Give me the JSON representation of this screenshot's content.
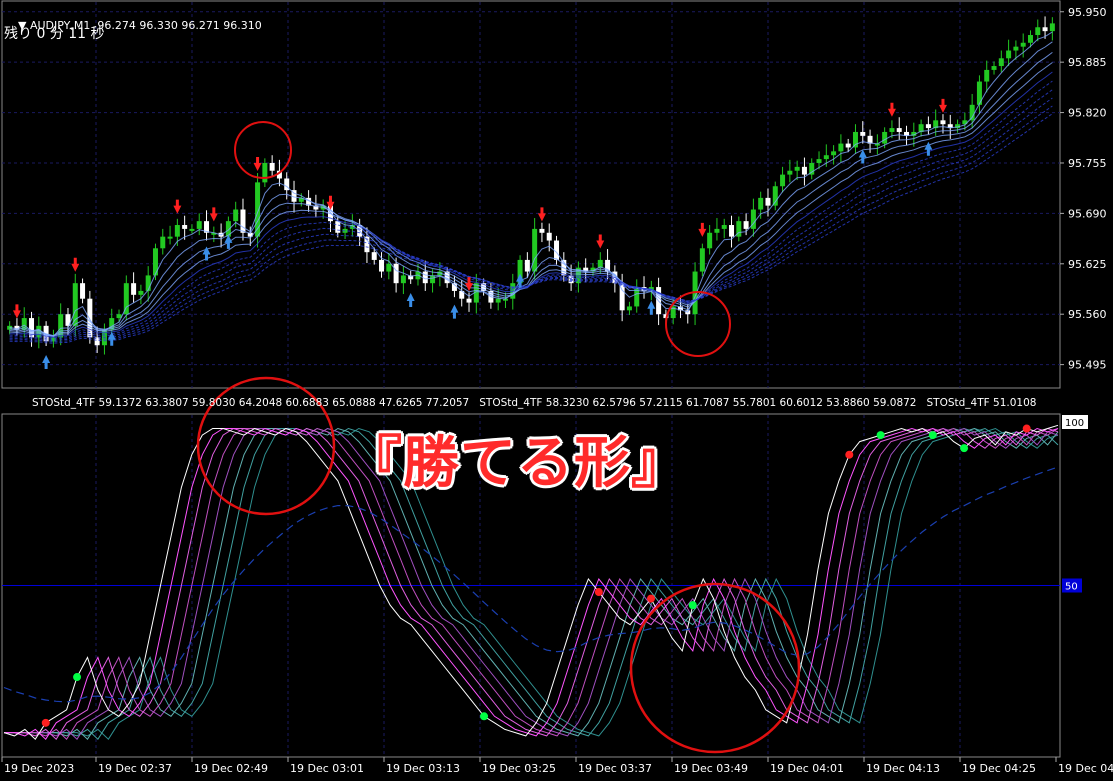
{
  "window": {
    "symbol_line": "AUDJPY,M1  96.274 96.330 96.271 96.310",
    "countdown": "残り 0 分 11 秒"
  },
  "price_axis": {
    "labels": [
      "95.950",
      "95.885",
      "95.820",
      "95.755",
      "95.690",
      "95.625",
      "95.560",
      "95.495"
    ]
  },
  "indicator": {
    "header": "STOStd_4TF 59.1372 63.3807 59.8030 64.2048 60.6883 65.0888 47.6265 77.2057   STOStd_4TF 58.3230 62.5796 57.2115 61.7087 55.7801 60.6012 53.8860 59.0872   STOStd_4TF 51.0108",
    "level_100": "100",
    "level_50": "50"
  },
  "time_axis": {
    "labels": [
      "19 Dec 2023",
      "19 Dec 02:37",
      "19 Dec 02:49",
      "19 Dec 03:01",
      "19 Dec 03:13",
      "19 Dec 03:25",
      "19 Dec 03:37",
      "19 Dec 03:49",
      "19 Dec 04:01",
      "19 Dec 04:13",
      "19 Dec 04:25",
      "19 Dec 04"
    ]
  },
  "annotation": {
    "label": "『勝てる形』",
    "color": "#ff2b2b"
  },
  "colors": {
    "background": "#000000",
    "grid": "#1a1a60",
    "bull_candle": "#22c922",
    "bear_candle": "#ffffff",
    "down_arrow": "#ff2020",
    "up_arrow": "#3a8ee8",
    "circle": "#e01010",
    "level_50_line": "#0000d8"
  },
  "chart_data": [
    {
      "type": "candlestick",
      "title": "AUDJPY,M1",
      "ylim": [
        95.47,
        95.96
      ],
      "price": [
        95.545,
        95.54,
        95.555,
        95.53,
        95.545,
        95.525,
        95.53,
        95.56,
        95.545,
        95.6,
        95.58,
        95.53,
        95.52,
        95.54,
        95.555,
        95.56,
        95.6,
        95.585,
        95.59,
        95.61,
        95.645,
        95.66,
        95.66,
        95.675,
        95.67,
        95.67,
        95.68,
        95.665,
        95.665,
        95.66,
        95.68,
        95.695,
        95.665,
        95.66,
        95.73,
        95.755,
        95.745,
        95.735,
        95.72,
        95.705,
        95.71,
        95.7,
        95.695,
        95.7,
        95.68,
        95.665,
        95.67,
        95.675,
        95.66,
        95.64,
        95.63,
        95.615,
        95.625,
        95.6,
        95.61,
        95.605,
        95.615,
        95.6,
        95.61,
        95.615,
        95.6,
        95.59,
        95.58,
        95.575,
        95.6,
        95.59,
        95.575,
        95.58,
        95.58,
        95.6,
        95.63,
        95.615,
        95.67,
        95.665,
        95.655,
        95.63,
        95.61,
        95.6,
        95.62,
        95.615,
        95.62,
        95.63,
        95.615,
        95.6,
        95.565,
        95.57,
        95.595,
        95.59,
        95.595,
        95.56,
        95.555,
        95.57,
        95.565,
        95.56,
        95.615,
        95.645,
        95.665,
        95.67,
        95.675,
        95.66,
        95.68,
        95.67,
        95.695,
        95.71,
        95.7,
        95.725,
        95.74,
        95.745,
        95.75,
        95.74,
        95.755,
        95.76,
        95.765,
        95.77,
        95.78,
        95.775,
        95.795,
        95.79,
        95.78,
        95.78,
        95.795,
        95.8,
        95.795,
        95.79,
        95.795,
        95.805,
        95.8,
        95.81,
        95.805,
        95.8,
        95.805,
        95.81,
        95.83,
        95.86,
        95.875,
        95.88,
        95.89,
        95.9,
        95.905,
        95.91,
        95.92,
        95.93,
        95.925,
        95.935
      ]
    },
    {
      "type": "line",
      "title": "STOStd_4TF",
      "ylim": [
        0,
        100
      ],
      "stoch": [
        5,
        4,
        6,
        3,
        8,
        10,
        12,
        22,
        28,
        18,
        12,
        10,
        14,
        20,
        35,
        50,
        65,
        80,
        90,
        96,
        98,
        98,
        97,
        96,
        98,
        97,
        96,
        98,
        97,
        94,
        90,
        86,
        82,
        74,
        66,
        58,
        50,
        44,
        40,
        38,
        34,
        30,
        26,
        22,
        18,
        14,
        10,
        8,
        6,
        5,
        4,
        8,
        14,
        24,
        34,
        44,
        52,
        48,
        44,
        40,
        38,
        42,
        46,
        40,
        34,
        30,
        44,
        52,
        46,
        36,
        28,
        22,
        18,
        12,
        10,
        8,
        20,
        35,
        55,
        72,
        82,
        90,
        94,
        95,
        96,
        97,
        98,
        97,
        98,
        96,
        97,
        94,
        92,
        95,
        96,
        93,
        97,
        96,
        98,
        97,
        98,
        99
      ]
    }
  ]
}
